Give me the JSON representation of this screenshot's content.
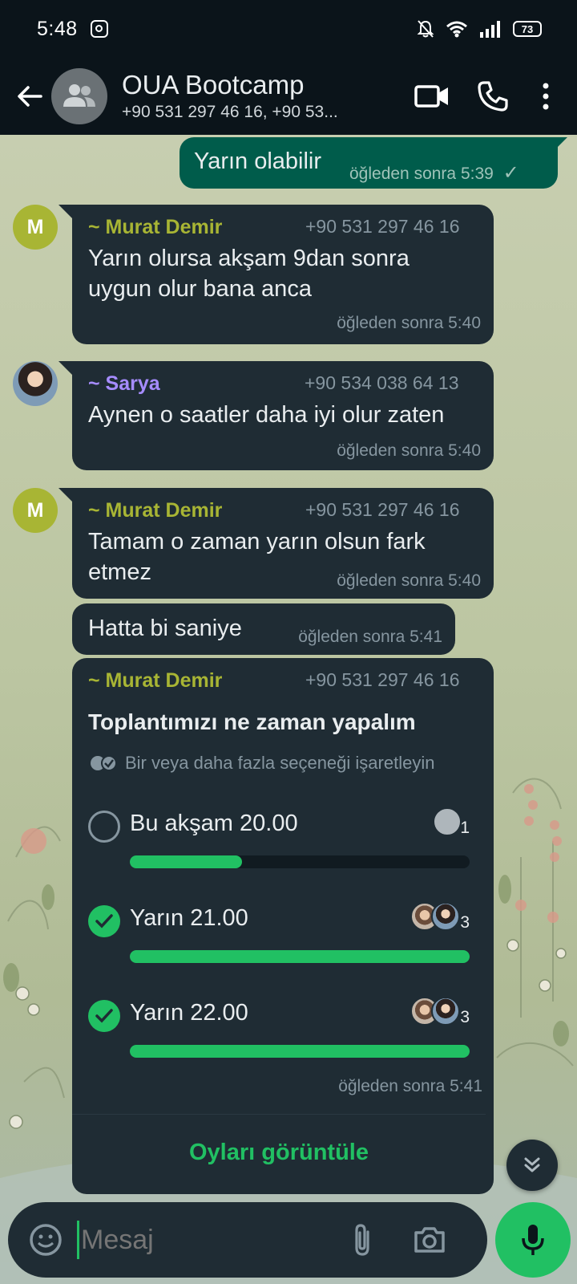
{
  "status_bar": {
    "time": "5:48",
    "battery": "73"
  },
  "header": {
    "title": "OUA Bootcamp",
    "members": "+90 531 297 46 16, +90 53..."
  },
  "messages": [
    {
      "type": "outgoing",
      "text": "Yarın olabilir",
      "time": "öğleden sonra 5:39",
      "status": "✓"
    },
    {
      "type": "incoming",
      "avatar_letter": "M",
      "sender": "~ Murat Demir",
      "sender_color": "#a8b534",
      "phone": "+90 531 297 46 16",
      "text_lines": [
        "Yarın olursa akşam 9dan sonra",
        "uygun olur bana anca"
      ],
      "time": "öğleden sonra 5:40"
    },
    {
      "type": "incoming",
      "sender": "~ Sarya",
      "sender_color": "#a68cff",
      "phone": "+90 534 038 64 13",
      "text": "Aynen o saatler daha iyi olur zaten",
      "time": "öğleden sonra 5:40"
    },
    {
      "type": "incoming",
      "avatar_letter": "M",
      "sender": "~ Murat Demir",
      "sender_color": "#a8b534",
      "phone": "+90 531 297 46 16",
      "text_lines": [
        "Tamam o zaman yarın olsun fark",
        "etmez"
      ],
      "time": "öğleden sonra 5:40"
    },
    {
      "type": "incoming",
      "text": "Hatta bi saniye",
      "time": "öğleden sonra 5:41"
    }
  ],
  "poll": {
    "sender": "~ Murat Demir",
    "phone": "+90 531 297 46 16",
    "title": "Toplantımızı ne zaman yapalım",
    "hint": "Bir veya daha fazla seçeneği işaretleyin",
    "options": [
      {
        "label": "Bu akşam 20.00",
        "votes": "1",
        "checked": false,
        "fraction": 0.33
      },
      {
        "label": "Yarın 21.00",
        "votes": "3",
        "checked": true,
        "fraction": 1.0
      },
      {
        "label": "Yarın 22.00",
        "votes": "3",
        "checked": true,
        "fraction": 1.0
      }
    ],
    "time": "öğleden sonra 5:41",
    "view_votes": "Oyları görüntüle"
  },
  "composer": {
    "placeholder": "Mesaj"
  },
  "colors": {
    "accent": "#21c063",
    "incoming_bubble": "#1f2c34",
    "outgoing_bubble": "#005c4b",
    "header_bg": "#0b141a"
  }
}
